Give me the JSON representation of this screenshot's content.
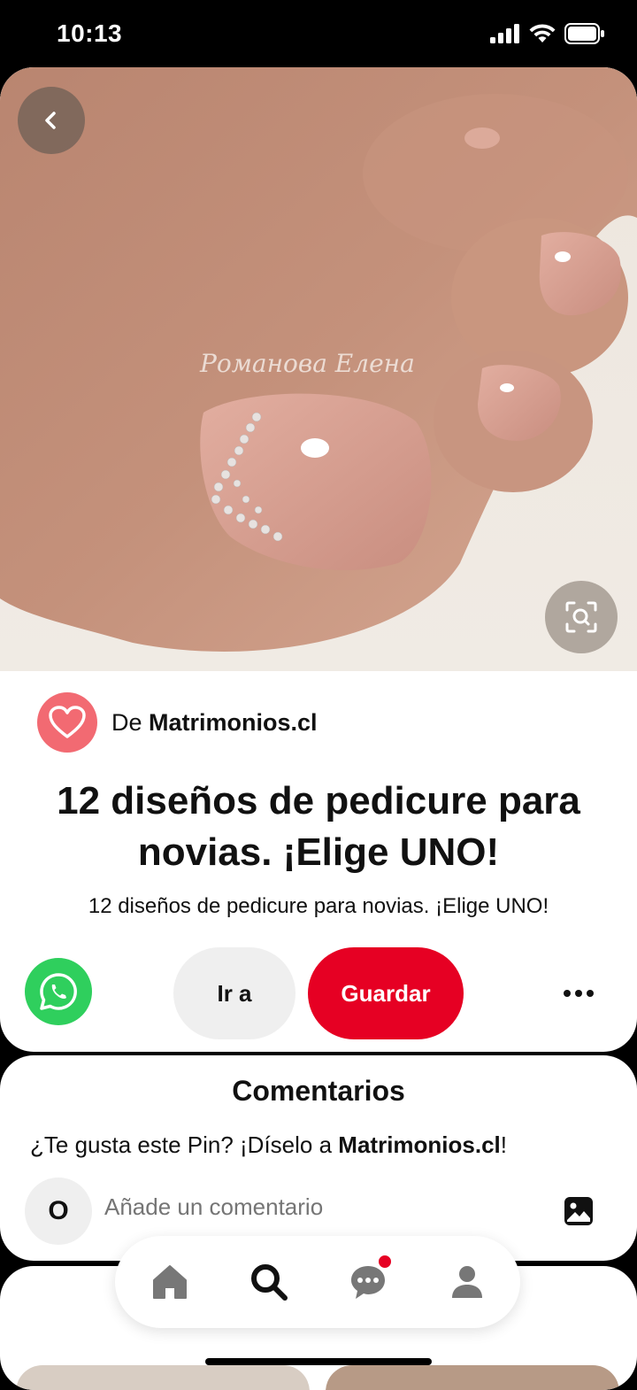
{
  "status_bar": {
    "time": "10:13"
  },
  "pin": {
    "image_watermark": "Романова Елена",
    "source_prefix": "De",
    "source_name": "Matrimonios.cl",
    "title": "12 diseños de pedicure para novias. ¡Elige UNO!",
    "description": "12 diseños de pedicure para novias. ¡Elige UNO!"
  },
  "actions": {
    "visit_label": "Ir a",
    "save_label": "Guardar"
  },
  "comments": {
    "title": "Comentarios",
    "prompt_prefix": "¿Te gusta este Pin? ¡Díselo a ",
    "prompt_name": "Matrimonios.cl",
    "prompt_suffix": "!",
    "user_initial": "O",
    "input_placeholder": "Añade un comentario"
  },
  "colors": {
    "save_button": "#e60023",
    "whatsapp": "#2fcf5d",
    "source_avatar": "#f26a72"
  },
  "icons": [
    "back-icon",
    "visual-search-icon",
    "heart-icon",
    "whatsapp-icon",
    "more-icon",
    "photo-icon",
    "home-icon",
    "search-icon",
    "messages-icon",
    "profile-icon"
  ]
}
